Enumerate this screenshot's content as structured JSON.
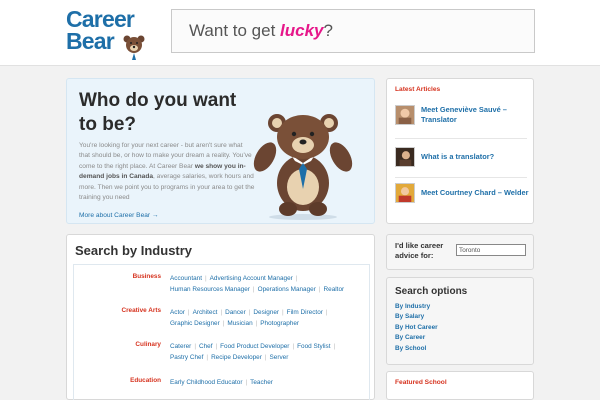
{
  "logo": {
    "line1": "Career",
    "line2": "Bear"
  },
  "banner": {
    "prefix": "Want to get ",
    "lucky": "lucky",
    "suffix": "?"
  },
  "hero": {
    "title": "Who do you want to be?",
    "desc_part1": "You're looking for your next career - but aren't sure what that should be, or how to make your dream a reality. You've come to the right place. At Career Bear ",
    "desc_bold": "we show you in-demand jobs in Canada",
    "desc_part2": ", average salaries, work hours and more. Then we point you to programs in your area to get the training you need",
    "more": "More about Career Bear →"
  },
  "industry": {
    "title": "Search by Industry",
    "rows": [
      {
        "category": "Business",
        "links": [
          "Accountant",
          "Advertising Account Manager",
          "Human Resources Manager",
          "Operations Manager",
          "Realtor"
        ]
      },
      {
        "category": "Creative Arts",
        "links": [
          "Actor",
          "Architect",
          "Dancer",
          "Designer",
          "Film Director",
          "Graphic Designer",
          "Musician",
          "Photographer"
        ]
      },
      {
        "category": "Culinary",
        "links": [
          "Caterer",
          "Chef",
          "Food Product Developer",
          "Food Stylist",
          "Pastry Chef",
          "Recipe Developer",
          "Server"
        ]
      },
      {
        "category": "Education",
        "links": [
          "Early Childhood Educator",
          "Teacher"
        ]
      }
    ]
  },
  "latest": {
    "title": "Latest Articles",
    "articles": [
      {
        "title": "Meet Geneviève Sauvé – Translator"
      },
      {
        "title": "What is a translator?"
      },
      {
        "title": "Meet Courtney Chard – Welder"
      }
    ]
  },
  "advice": {
    "label": "I'd like career advice for:",
    "value": "Toronto"
  },
  "options": {
    "title": "Search options",
    "items": [
      "By Industry",
      "By Salary",
      "By Hot Career",
      "By Career",
      "By School"
    ]
  },
  "featured": {
    "title": "Featured School"
  },
  "colors": {
    "brand_blue": "#1e6fa8",
    "accent_red": "#d6331f",
    "lucky_pink": "#e6178a"
  }
}
